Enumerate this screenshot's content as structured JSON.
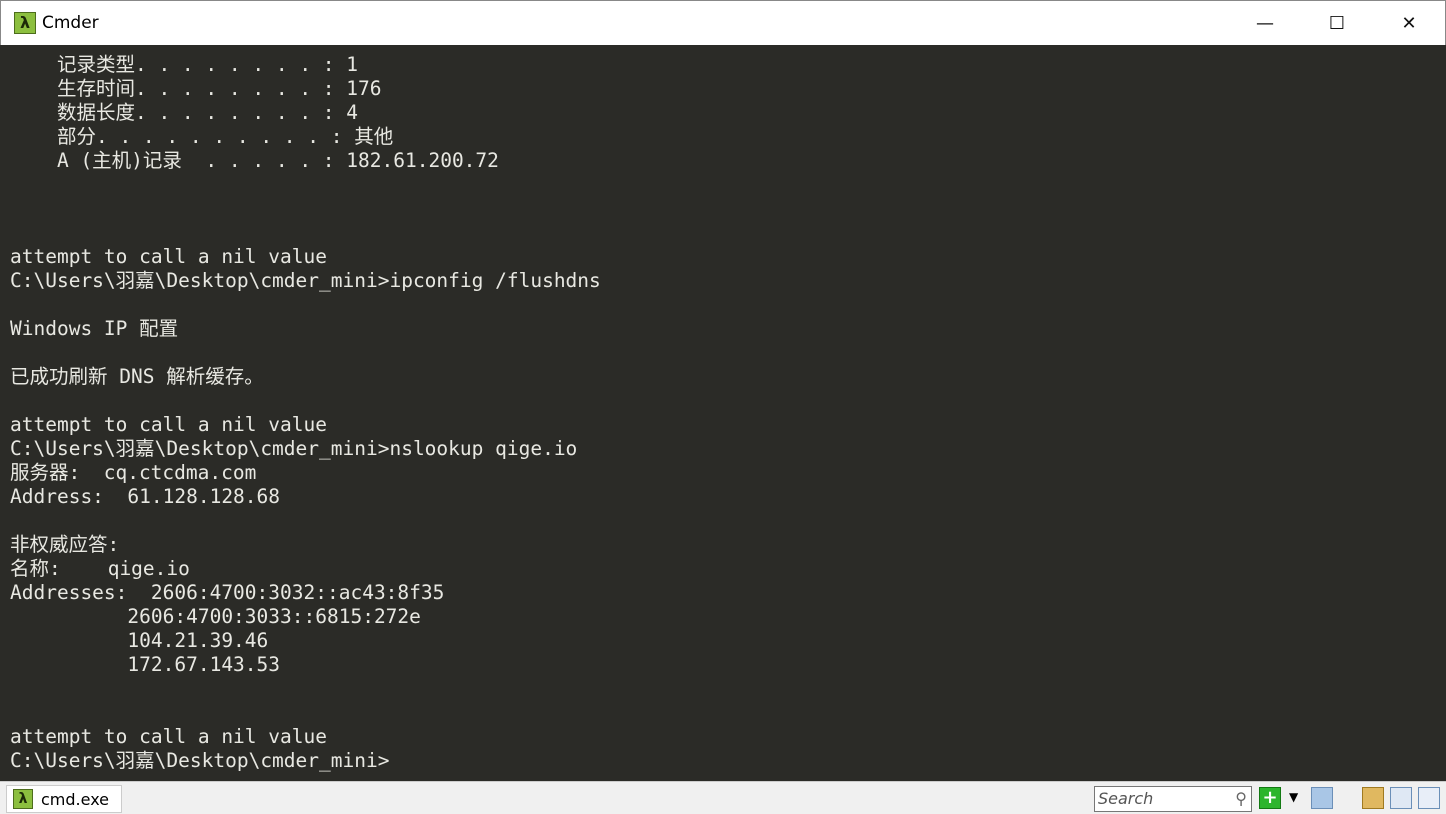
{
  "window": {
    "title": "Cmder",
    "minimize": "—",
    "maximize": "☐",
    "close": "✕"
  },
  "terminal": {
    "lines": [
      "    记录类型. . . . . . . . : 1",
      "    生存时间. . . . . . . . : 176",
      "    数据长度. . . . . . . . : 4",
      "    部分. . . . . . . . . . : 其他",
      "    A (主机)记录  . . . . . : 182.61.200.72",
      "",
      "",
      "",
      "attempt to call a nil value",
      "C:\\Users\\羽嘉\\Desktop\\cmder_mini>ipconfig /flushdns",
      "",
      "Windows IP 配置",
      "",
      "已成功刷新 DNS 解析缓存。",
      "",
      "attempt to call a nil value",
      "C:\\Users\\羽嘉\\Desktop\\cmder_mini>nslookup qige.io",
      "服务器:  cq.ctcdma.com",
      "Address:  61.128.128.68",
      "",
      "非权威应答:",
      "名称:    qige.io",
      "Addresses:  2606:4700:3032::ac43:8f35",
      "          2606:4700:3033::6815:272e",
      "          104.21.39.46",
      "          172.67.143.53",
      "",
      "",
      "attempt to call a nil value",
      "C:\\Users\\羽嘉\\Desktop\\cmder_mini>"
    ]
  },
  "statusbar": {
    "tab_label": "cmd.exe",
    "search_placeholder": "Search",
    "add_icon": "plus-icon"
  },
  "colors": {
    "background": "#2b2b27",
    "text": "#e8e8e2",
    "accent": "#8cbf3f"
  }
}
